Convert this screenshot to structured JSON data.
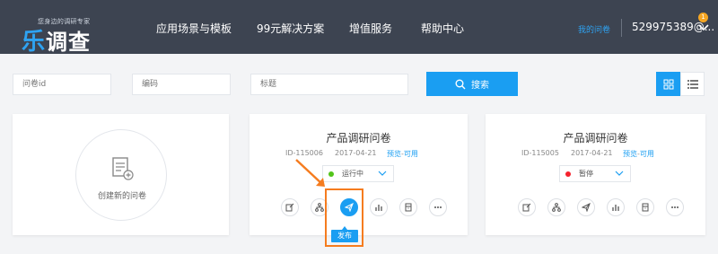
{
  "header": {
    "logo_slogan": "您身边的调研专家",
    "logo_mark": "乐",
    "logo_text": "调查",
    "nav": [
      "应用场景与模板",
      "99元解决方案",
      "增值服务",
      "帮助中心"
    ],
    "my_survey": "我的问卷",
    "user": "529975389@...",
    "badge_count": "1"
  },
  "filters": {
    "survey_id_placeholder": "问卷id",
    "code_placeholder": "编码",
    "title_placeholder": "标题",
    "search_label": "搜索"
  },
  "cards": {
    "create_label": "创建新的问卷",
    "items": [
      {
        "title": "产品调研问卷",
        "id": "ID-115006",
        "date": "2017-04-21",
        "preview": "预览",
        "sep": "-",
        "avail": "可用",
        "status": "运行中",
        "status_color": "#52c41a"
      },
      {
        "title": "产品调研问卷",
        "id": "ID-115005",
        "date": "2017-04-21",
        "preview": "预览",
        "sep": "-",
        "avail": "可用",
        "status": "暂停",
        "status_color": "#f5222d"
      }
    ]
  },
  "tooltip": "发布",
  "colors": {
    "header_bg": "#3d4451",
    "accent": "#1a9ef2",
    "highlight": "#f57c1f"
  }
}
